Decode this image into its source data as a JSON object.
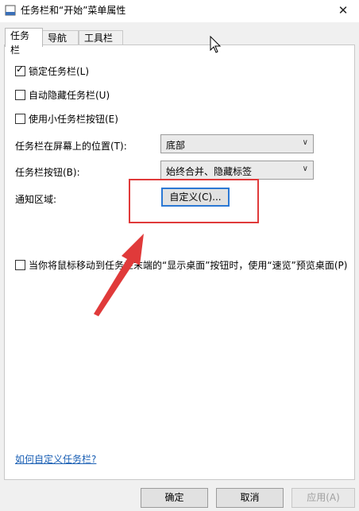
{
  "window": {
    "title": "任务栏和“开始”菜单属性",
    "close_label": "✕"
  },
  "tabs": [
    {
      "label": "任务栏",
      "active": true
    },
    {
      "label": "导航",
      "active": false
    },
    {
      "label": "工具栏",
      "active": false
    }
  ],
  "checkboxes": [
    {
      "label": "锁定任务栏(L)",
      "checked": true
    },
    {
      "label": "自动隐藏任务栏(U)",
      "checked": false
    },
    {
      "label": "使用小任务栏按钮(E)",
      "checked": false
    },
    {
      "label": "当你将鼠标移动到任务栏末端的“显示桌面”按钮时，使用“速览”预览桌面(P)",
      "checked": false
    }
  ],
  "position_row": {
    "label": "任务栏在屏幕上的位置(T):",
    "value": "底部"
  },
  "buttons_row": {
    "label": "任务栏按钮(B):",
    "value": "始终合并、隐藏标签"
  },
  "notify_row": {
    "label": "通知区域:",
    "button_label": "自定义(C)..."
  },
  "help_link": "如何自定义任务栏?",
  "footer": {
    "ok": "确定",
    "cancel": "取消",
    "apply": "应用(A)"
  },
  "colors": {
    "highlight": "#e03a3a",
    "accent": "#2b78d4",
    "link": "#1a5fb4"
  }
}
